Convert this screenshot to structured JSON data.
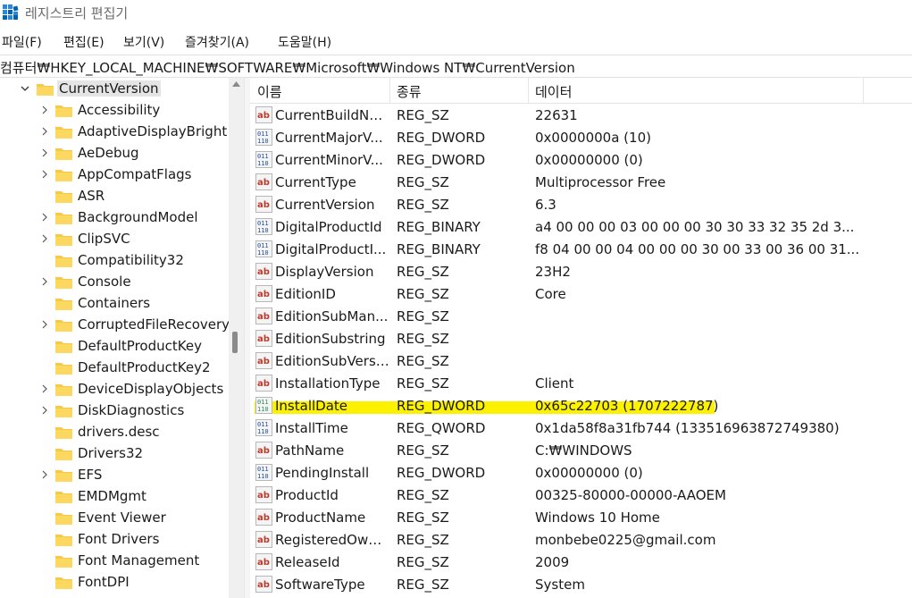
{
  "window": {
    "title": "레지스트리 편집기"
  },
  "menu": [
    "파일(F)",
    "편집(E)",
    "보기(V)",
    "즐겨찾기(A)",
    "도움말(H)"
  ],
  "address": "컴퓨터₩HKEY_LOCAL_MACHINE₩SOFTWARE₩Microsoft₩Windows NT₩CurrentVersion",
  "tree": {
    "root": "CurrentVersion",
    "items": [
      {
        "label": "Accessibility",
        "expandable": true
      },
      {
        "label": "AdaptiveDisplayBright",
        "expandable": true
      },
      {
        "label": "AeDebug",
        "expandable": true
      },
      {
        "label": "AppCompatFlags",
        "expandable": true
      },
      {
        "label": "ASR",
        "expandable": false
      },
      {
        "label": "BackgroundModel",
        "expandable": true
      },
      {
        "label": "ClipSVC",
        "expandable": true
      },
      {
        "label": "Compatibility32",
        "expandable": false
      },
      {
        "label": "Console",
        "expandable": true
      },
      {
        "label": "Containers",
        "expandable": false
      },
      {
        "label": "CorruptedFileRecovery",
        "expandable": true
      },
      {
        "label": "DefaultProductKey",
        "expandable": false
      },
      {
        "label": "DefaultProductKey2",
        "expandable": false
      },
      {
        "label": "DeviceDisplayObjects",
        "expandable": true
      },
      {
        "label": "DiskDiagnostics",
        "expandable": true
      },
      {
        "label": "drivers.desc",
        "expandable": false
      },
      {
        "label": "Drivers32",
        "expandable": false
      },
      {
        "label": "EFS",
        "expandable": true
      },
      {
        "label": "EMDMgmt",
        "expandable": false
      },
      {
        "label": "Event Viewer",
        "expandable": false
      },
      {
        "label": "Font Drivers",
        "expandable": false
      },
      {
        "label": "Font Management",
        "expandable": false
      },
      {
        "label": "FontDPI",
        "expandable": false
      }
    ]
  },
  "columns": {
    "name": "이름",
    "type": "종류",
    "data": "데이터"
  },
  "values": [
    {
      "name": "CurrentBuildNu...",
      "type": "REG_SZ",
      "data": "22631",
      "icon": "string-value-icon"
    },
    {
      "name": "CurrentMajorV...",
      "type": "REG_DWORD",
      "data": "0x0000000a (10)",
      "icon": "binary-value-icon"
    },
    {
      "name": "CurrentMinorV...",
      "type": "REG_DWORD",
      "data": "0x00000000 (0)",
      "icon": "binary-value-icon"
    },
    {
      "name": "CurrentType",
      "type": "REG_SZ",
      "data": "Multiprocessor Free",
      "icon": "string-value-icon"
    },
    {
      "name": "CurrentVersion",
      "type": "REG_SZ",
      "data": "6.3",
      "icon": "string-value-icon"
    },
    {
      "name": "DigitalProductId",
      "type": "REG_BINARY",
      "data": "a4 00 00 00 03 00 00 00 30 30 33 32 35 2d 3...",
      "icon": "binary-value-icon"
    },
    {
      "name": "DigitalProductI...",
      "type": "REG_BINARY",
      "data": "f8 04 00 00 04 00 00 00 30 00 33 00 36 00 31...",
      "icon": "binary-value-icon"
    },
    {
      "name": "DisplayVersion",
      "type": "REG_SZ",
      "data": "23H2",
      "icon": "string-value-icon"
    },
    {
      "name": "EditionID",
      "type": "REG_SZ",
      "data": "Core",
      "icon": "string-value-icon"
    },
    {
      "name": "EditionSubMan...",
      "type": "REG_SZ",
      "data": "",
      "icon": "string-value-icon"
    },
    {
      "name": "EditionSubstring",
      "type": "REG_SZ",
      "data": "",
      "icon": "string-value-icon"
    },
    {
      "name": "EditionSubVersi...",
      "type": "REG_SZ",
      "data": "",
      "icon": "string-value-icon"
    },
    {
      "name": "InstallationType",
      "type": "REG_SZ",
      "data": "Client",
      "icon": "string-value-icon"
    },
    {
      "name": "InstallDate",
      "type": "REG_DWORD",
      "data": "0x65c22703 (1707222787)",
      "icon": "binary-value-icon",
      "highlighted": true
    },
    {
      "name": "InstallTime",
      "type": "REG_QWORD",
      "data": "0x1da58f8a31fb744 (133516963872749380)",
      "icon": "binary-value-icon"
    },
    {
      "name": "PathName",
      "type": "REG_SZ",
      "data": "C:₩WINDOWS",
      "icon": "string-value-icon"
    },
    {
      "name": "PendingInstall",
      "type": "REG_DWORD",
      "data": "0x00000000 (0)",
      "icon": "binary-value-icon"
    },
    {
      "name": "ProductId",
      "type": "REG_SZ",
      "data": "00325-80000-00000-AAOEM",
      "icon": "string-value-icon"
    },
    {
      "name": "ProductName",
      "type": "REG_SZ",
      "data": "Windows 10 Home",
      "icon": "string-value-icon"
    },
    {
      "name": "RegisteredOwn...",
      "type": "REG_SZ",
      "data": "monbebe0225@gmail.com",
      "icon": "string-value-icon"
    },
    {
      "name": "ReleaseId",
      "type": "REG_SZ",
      "data": "2009",
      "icon": "string-value-icon"
    },
    {
      "name": "SoftwareType",
      "type": "REG_SZ",
      "data": "System",
      "icon": "string-value-icon"
    }
  ],
  "colors": {
    "highlight": "#fcf200",
    "folder": "#f7c948",
    "string_icon": "#c0392b",
    "binary_icon": "#1f4e9c"
  }
}
